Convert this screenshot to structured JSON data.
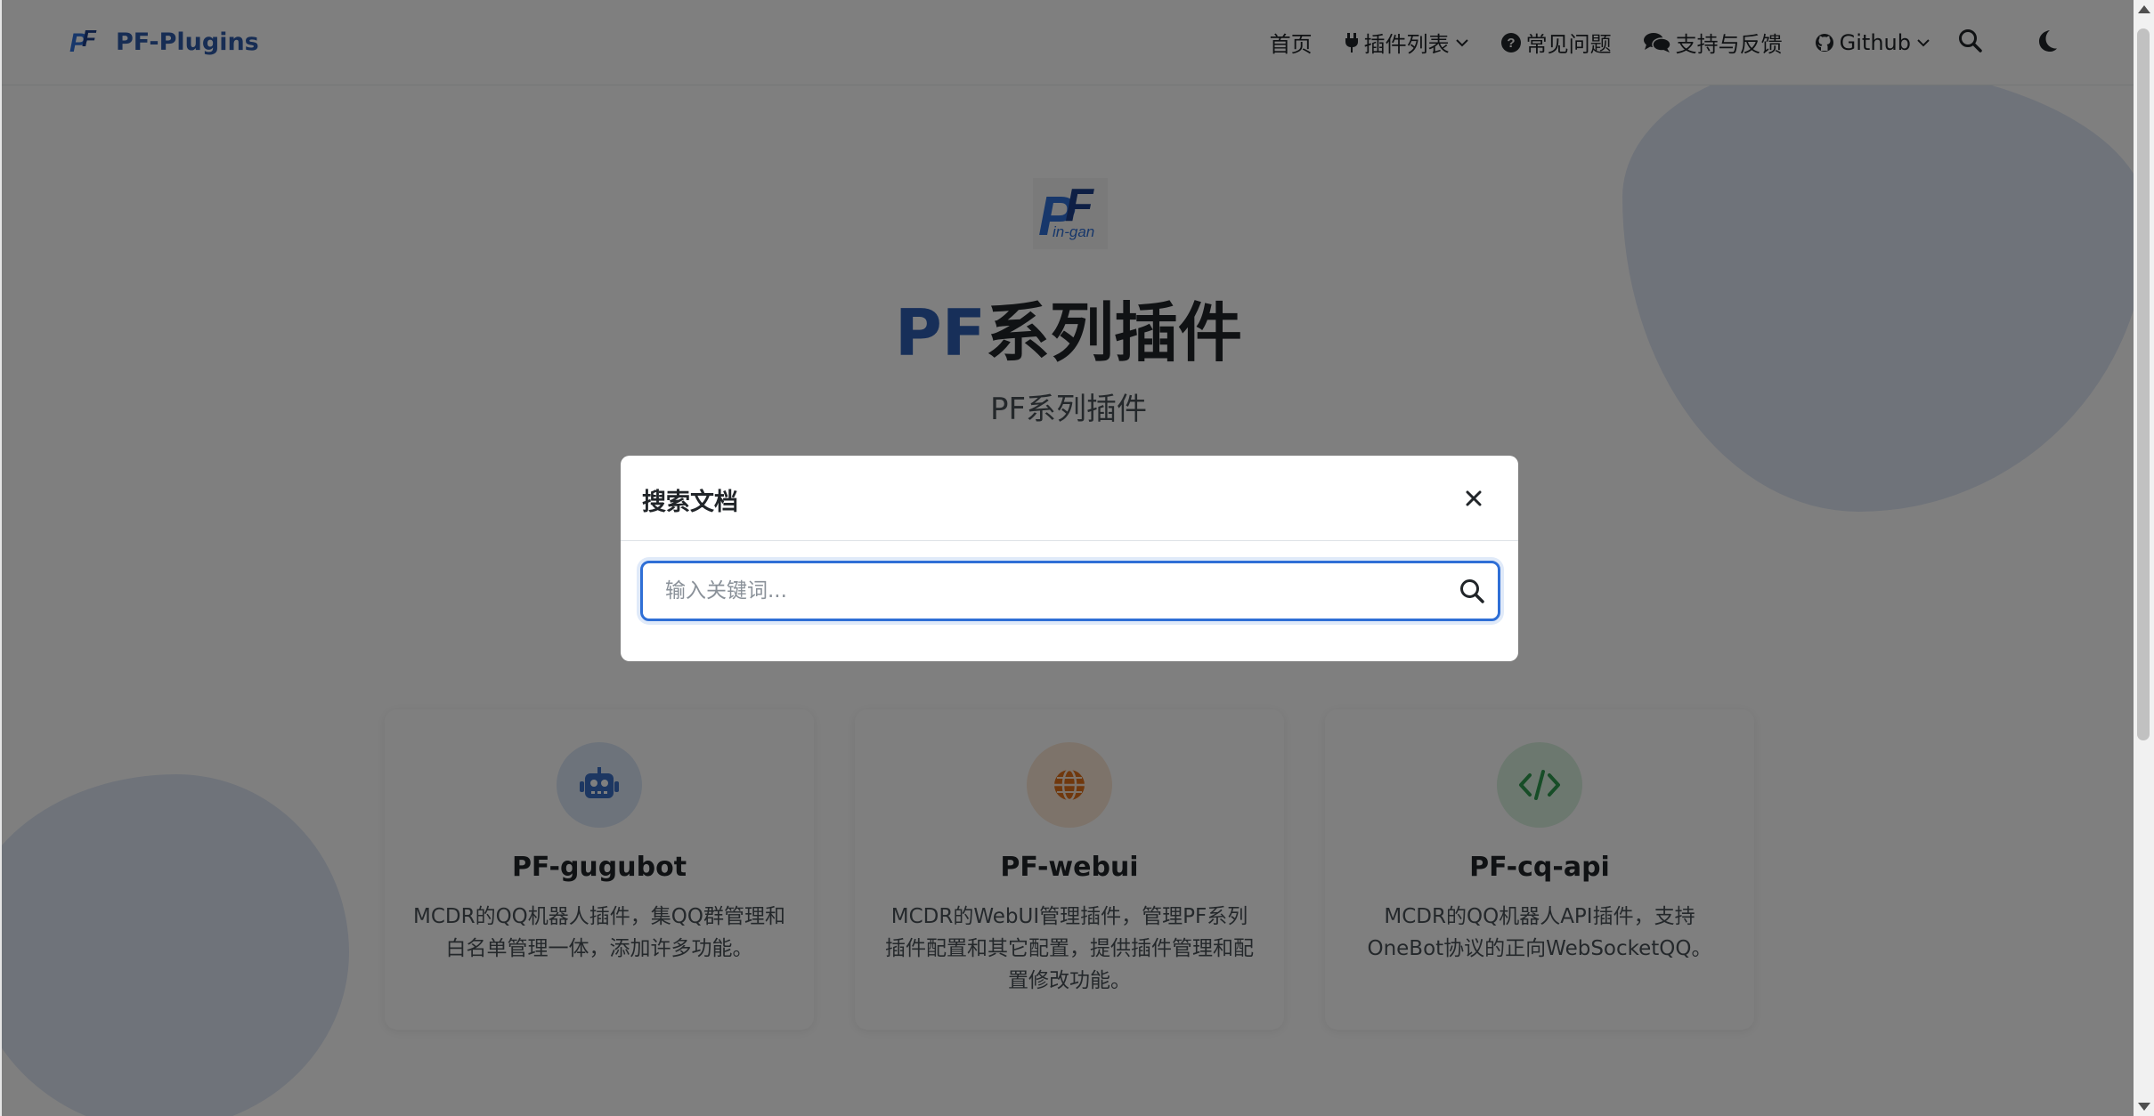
{
  "navbar": {
    "brand": "PF-Plugins",
    "items": [
      {
        "label": "首页",
        "icon": ""
      },
      {
        "label": "插件列表",
        "icon": "plug-icon",
        "dropdown": true
      },
      {
        "label": "常见问题",
        "icon": "question-circle-icon"
      },
      {
        "label": "支持与反馈",
        "icon": "comments-icon"
      },
      {
        "label": "Github",
        "icon": "github-icon",
        "dropdown": true
      }
    ]
  },
  "hero": {
    "logo_text": "PF",
    "logo_sub": "in-gan",
    "title_accent": "PF",
    "title_rest": "系列插件",
    "subtitle": "PF系列插件"
  },
  "cards": [
    {
      "title": "PF-gugubot",
      "desc": "MCDR的QQ机器人插件，集QQ群管理和白名单管理一体，添加许多功能。",
      "icon": "robot-icon",
      "color": "#3a6fc4",
      "bg": "#dbe6f7"
    },
    {
      "title": "PF-webui",
      "desc": "MCDR的WebUI管理插件，管理PF系列插件配置和其它配置，提供插件管理和配置修改功能。",
      "icon": "globe-icon",
      "color": "#e0701a",
      "bg": "#fbe6d4"
    },
    {
      "title": "PF-cq-api",
      "desc": "MCDR的QQ机器人API插件，支持OneBot协议的正向WebSocketQQ。",
      "icon": "code-icon",
      "color": "#2f9a4e",
      "bg": "#d9f0df"
    }
  ],
  "modal": {
    "title": "搜索文档",
    "search_placeholder": "输入关键词...",
    "search_value": ""
  },
  "colors": {
    "accent": "#2f5fb3",
    "focus_border": "#2f6fd6",
    "overlay": "rgba(0,0,0,0.5)"
  }
}
